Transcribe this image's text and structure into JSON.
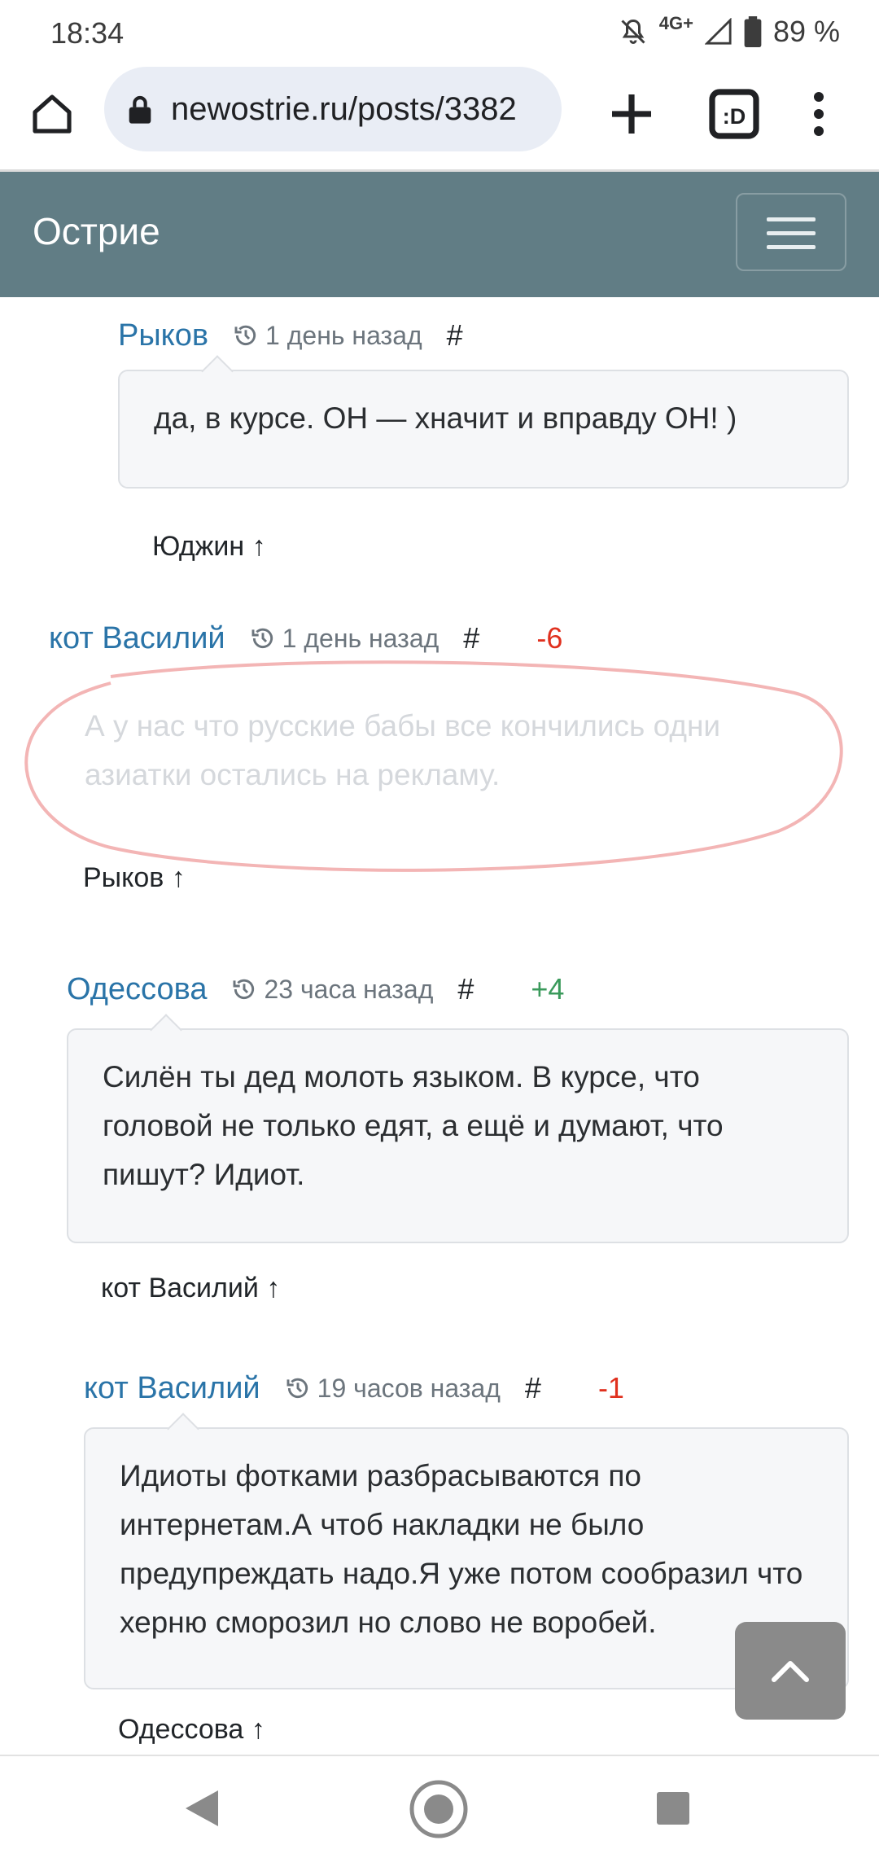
{
  "status_bar": {
    "time": "18:34",
    "network": "4G+",
    "battery": "89 %",
    "icons": [
      "mute-bell-icon",
      "signal-icon",
      "battery-icon"
    ]
  },
  "browser": {
    "url": "newostrie.ru/posts/3382",
    "tab_count_label": ":D",
    "icons": [
      "home-icon",
      "lock-icon",
      "plus-icon",
      "tabs-icon",
      "more-vert-icon"
    ]
  },
  "site": {
    "brand": "Острие",
    "colors": {
      "navbar": "#617d85",
      "author": "#2a74a8",
      "positive": "#3a9a5b",
      "negative": "#e0301e"
    }
  },
  "comments": [
    {
      "author": "Рыков",
      "time": "1 день назад",
      "anchor": "#",
      "score": "",
      "text": "да, в курсе. ОН — хначит и вправду ОН! )",
      "reply_to": "Юджин ↑"
    },
    {
      "author": "кот Василий",
      "time": "1 день назад",
      "anchor": "#",
      "score": "-6",
      "text": "А у нас что русские бабы все кончились одни азиатки остались на рекламу.",
      "reply_to": "Рыков ↑"
    },
    {
      "author": "Одессова",
      "time": "23 часа назад",
      "anchor": "#",
      "score": "+4",
      "text": "Силён ты дед молоть языком. В курсе, что головой не только едят, а ещё и думают, что пишут? Идиот.",
      "reply_to": "кот Василий ↑"
    },
    {
      "author": "кот Василий",
      "time": "19 часов назад",
      "anchor": "#",
      "score": "-1",
      "text": "Идиоты фотками разбрасываются по интернетам.А чтоб накладки не было предупреждать надо.Я уже потом сообразил что херню сморозил но слово не воробей.",
      "reply_to": "Одессова ↑"
    }
  ]
}
